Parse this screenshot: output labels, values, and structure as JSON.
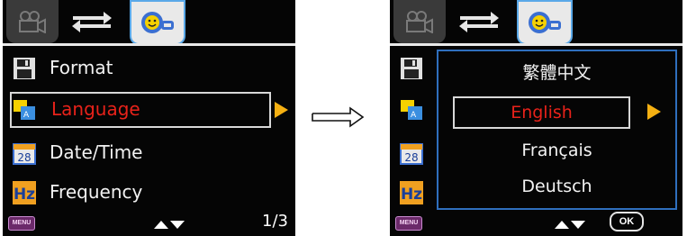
{
  "left_screen": {
    "tabs": [
      {
        "name": "camera-mode",
        "icon": "video-camera-icon"
      },
      {
        "name": "playback-mode",
        "icon": "swap-arrows-icon"
      },
      {
        "name": "settings",
        "icon": "gear-face-icon",
        "active": true
      }
    ],
    "menu_items": [
      {
        "label": "Format",
        "icon": "floppy-disk-icon"
      },
      {
        "label": "Language",
        "icon": "language-flag-icon",
        "selected": true
      },
      {
        "label": "Date/Time",
        "icon": "calendar-icon",
        "icon_text": "28"
      },
      {
        "label": "Frequency",
        "icon": "hz-icon",
        "icon_text": "Hz"
      }
    ],
    "bottom": {
      "menu_label": "MENU",
      "page": "1/3"
    }
  },
  "right_screen": {
    "languages": [
      {
        "label": "繁體中文"
      },
      {
        "label": "English",
        "selected": true
      },
      {
        "label": "Français"
      },
      {
        "label": "Deutsch"
      }
    ],
    "bottom": {
      "menu_label": "MENU",
      "ok_label": "OK"
    }
  },
  "colors": {
    "selected_text": "#e8221a",
    "arrow": "#f5b012",
    "dropdown_border": "#2f6fbe",
    "background": "#050505"
  }
}
